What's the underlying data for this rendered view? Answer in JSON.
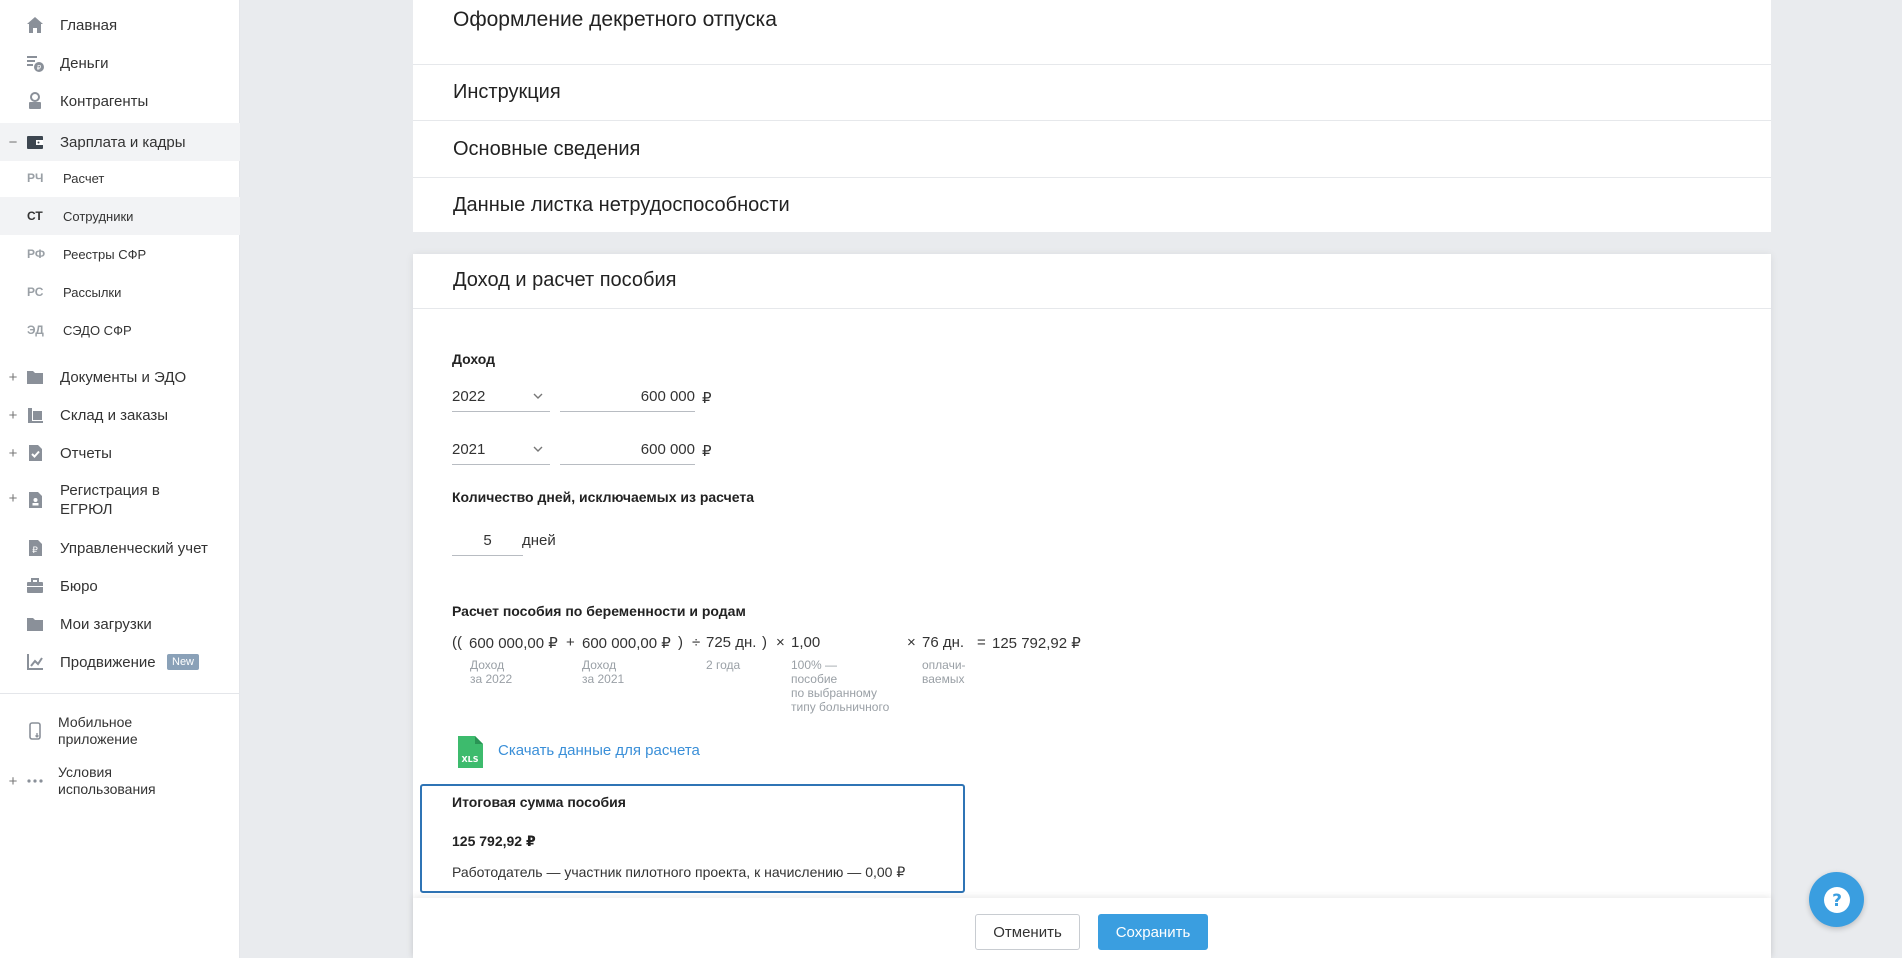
{
  "sidebar": {
    "items": [
      {
        "label": "Главная",
        "icon": "home-icon"
      },
      {
        "label": "Деньги",
        "icon": "money-icon"
      },
      {
        "label": "Контрагенты",
        "icon": "contractors-icon"
      },
      {
        "label": "Зарплата и кадры",
        "icon": "salary-icon",
        "expander": "−"
      }
    ],
    "sub_items": [
      {
        "abbr": "РЧ",
        "label": "Расчет"
      },
      {
        "abbr": "СТ",
        "label": "Сотрудники"
      },
      {
        "abbr": "РФ",
        "label": "Реестры СФР"
      },
      {
        "abbr": "РС",
        "label": "Рассылки"
      },
      {
        "abbr": "ЭД",
        "label": "СЭДО СФР"
      }
    ],
    "items2": [
      {
        "label": "Документы и ЭДО",
        "expander": "+"
      },
      {
        "label": "Склад и заказы",
        "expander": "+"
      },
      {
        "label": "Отчеты",
        "expander": "+"
      },
      {
        "label_line1": "Регистрация в",
        "label_line2": "ЕГРЮЛ",
        "expander": "+"
      },
      {
        "label": "Управленческий учет"
      },
      {
        "label": "Бюро"
      },
      {
        "label": "Мои загрузки"
      },
      {
        "label": "Продвижение",
        "badge": "New"
      }
    ],
    "bottom": [
      {
        "label_line1": "Мобильное",
        "label_line2": "приложение"
      },
      {
        "label_line1": "Условия",
        "label_line2": "использования",
        "expander": "+"
      }
    ]
  },
  "header": {
    "page_title": "Оформление декретного отпуска"
  },
  "sections": {
    "instruction": "Инструкция",
    "basic_info": "Основные сведения",
    "sick_leave": "Данные листка нетрудоспособности",
    "income_calc": "Доход и расчет пособия"
  },
  "income": {
    "title": "Доход",
    "rows": [
      {
        "year": "2022",
        "amount": "600 000",
        "currency": "₽"
      },
      {
        "year": "2021",
        "amount": "600 000",
        "currency": "₽"
      }
    ]
  },
  "excluded_days": {
    "title": "Количество дней, исключаемых из расчета",
    "value": "5",
    "unit": "дней"
  },
  "calculation": {
    "title": "Расчет пособия по беременности и родам",
    "open": "((",
    "income1": "600 000,00 ₽",
    "plus": "+",
    "income2": "600 000,00 ₽",
    "close": ")",
    "divide": "÷",
    "days": "725 дн.",
    "close2": ")",
    "times": "×",
    "coef": "1,00",
    "times2": "×",
    "paid_days": "76 дн.",
    "equals": "=",
    "result": "125 792,92 ₽",
    "cap_income1_l1": "Доход",
    "cap_income1_l2": "за 2022",
    "cap_income2_l1": "Доход",
    "cap_income2_l2": "за 2021",
    "cap_days": "2 года",
    "cap_coef_l1": "100% —",
    "cap_coef_l2": "пособие",
    "cap_coef_l3": "по выбранному",
    "cap_coef_l4": "типу больничного",
    "cap_paid_l1": "оплачи-",
    "cap_paid_l2": "ваемых"
  },
  "download": {
    "icon_text": "XLS",
    "label": "Скачать данные для расчета"
  },
  "total": {
    "title": "Итоговая сумма пособия",
    "amount": "125 792,92 ₽",
    "note": "Работодатель — участник пилотного проекта, к начислению — 0,00 ₽"
  },
  "footer": {
    "cancel": "Отменить",
    "save": "Сохранить"
  },
  "help": {
    "symbol": "?"
  },
  "colors": {
    "accent": "#3a9ee0",
    "link": "#3a8fd8",
    "highlight_border": "#2f74b5",
    "xls_green": "#3dbb6d",
    "background": "#e9ebee"
  }
}
